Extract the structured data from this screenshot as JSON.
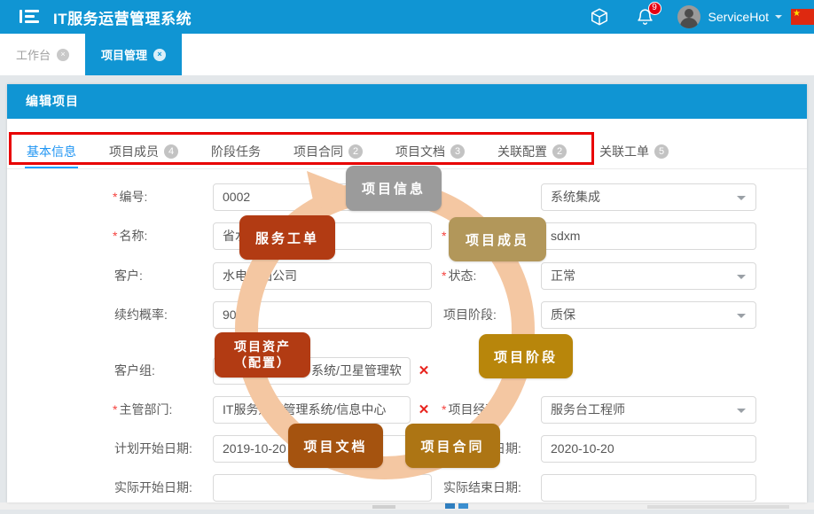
{
  "colors": {
    "header_blue": "#1095d3",
    "active_tab_blue": "#2196f3",
    "tab_underline_blue": "#1e9fff",
    "annotation_red": "#e80000",
    "required_star_red": "#f5413d",
    "remove_icon_red": "#e8231d",
    "ring_peach": "#f4c7a2",
    "node_gray": "#9b9b9b",
    "node_brick_red": "#b23b13",
    "node_khaki": "#b2975a",
    "node_goldenrod": "#b8860b",
    "node_brown_orange": "#a5530f",
    "node_amber": "#ad7514"
  },
  "app_header": {
    "title": "IT服务运营管理系统",
    "username": "ServiceHot",
    "notification_count": "9"
  },
  "window_tabs": {
    "items": [
      {
        "label": "工作台",
        "close": "×"
      },
      {
        "label": "项目管理",
        "close": "×"
      }
    ]
  },
  "panel": {
    "title": "编辑项目"
  },
  "detail_tabs": {
    "items": [
      {
        "label": "基本信息",
        "badge": ""
      },
      {
        "label": "项目成员",
        "badge": "4"
      },
      {
        "label": "阶段任务",
        "badge": ""
      },
      {
        "label": "项目合同",
        "badge": "2"
      },
      {
        "label": "项目文档",
        "badge": "3"
      },
      {
        "label": "关联配置",
        "badge": "2"
      },
      {
        "label": "关联工单",
        "badge": "5"
      }
    ]
  },
  "form": {
    "rows": [
      {
        "l_star": "*",
        "l_label": "编号:",
        "l_value": "0002",
        "r_star": "",
        "r_label": "",
        "r_value": "系统集成"
      },
      {
        "l_star": "*",
        "l_label": "名称:",
        "l_value": "省水",
        "r_star": "*",
        "r_label": "",
        "r_value": "sdxm"
      },
      {
        "l_star": "",
        "l_label": "客户:",
        "l_value": "水电集团公司",
        "r_star": "*",
        "r_label": "状态:",
        "r_value": "正常"
      },
      {
        "l_star": "",
        "l_label": "续约概率:",
        "l_value": "90",
        "r_star": "",
        "r_label": "项目阶段:",
        "r_value": "质保"
      },
      {
        "l_star": "",
        "l_label": "客户组:",
        "l_value": "系统/卫星管理软",
        "l_suffix": "✕"
      },
      {
        "l_star": "*",
        "l_label": "主管部门:",
        "l_value": "IT服务运营管理系统/信息中心",
        "l_suffix": "✕",
        "r_star": "*",
        "r_label": "项目经理:",
        "r_value": "服务台工程师"
      },
      {
        "l_star": "",
        "l_label": "计划开始日期:",
        "l_value": "2019-10-20",
        "r_star": "",
        "r_label": "计划结束日期:",
        "r_value": "2020-10-20"
      },
      {
        "l_star": "",
        "l_label": "实际开始日期:",
        "l_value": "",
        "r_star": "",
        "r_label": "实际结束日期:",
        "r_value": ""
      }
    ]
  },
  "overlay": {
    "nodes": {
      "info": {
        "label": "项目信息"
      },
      "ticket": {
        "label": "服务工单"
      },
      "member": {
        "label": "项目成员"
      },
      "asset": {
        "line1": "项目资产",
        "line2": "（配置）"
      },
      "phase": {
        "label": "项目阶段"
      },
      "document": {
        "label": "项目文档"
      },
      "contract": {
        "label": "项目合同"
      }
    }
  }
}
